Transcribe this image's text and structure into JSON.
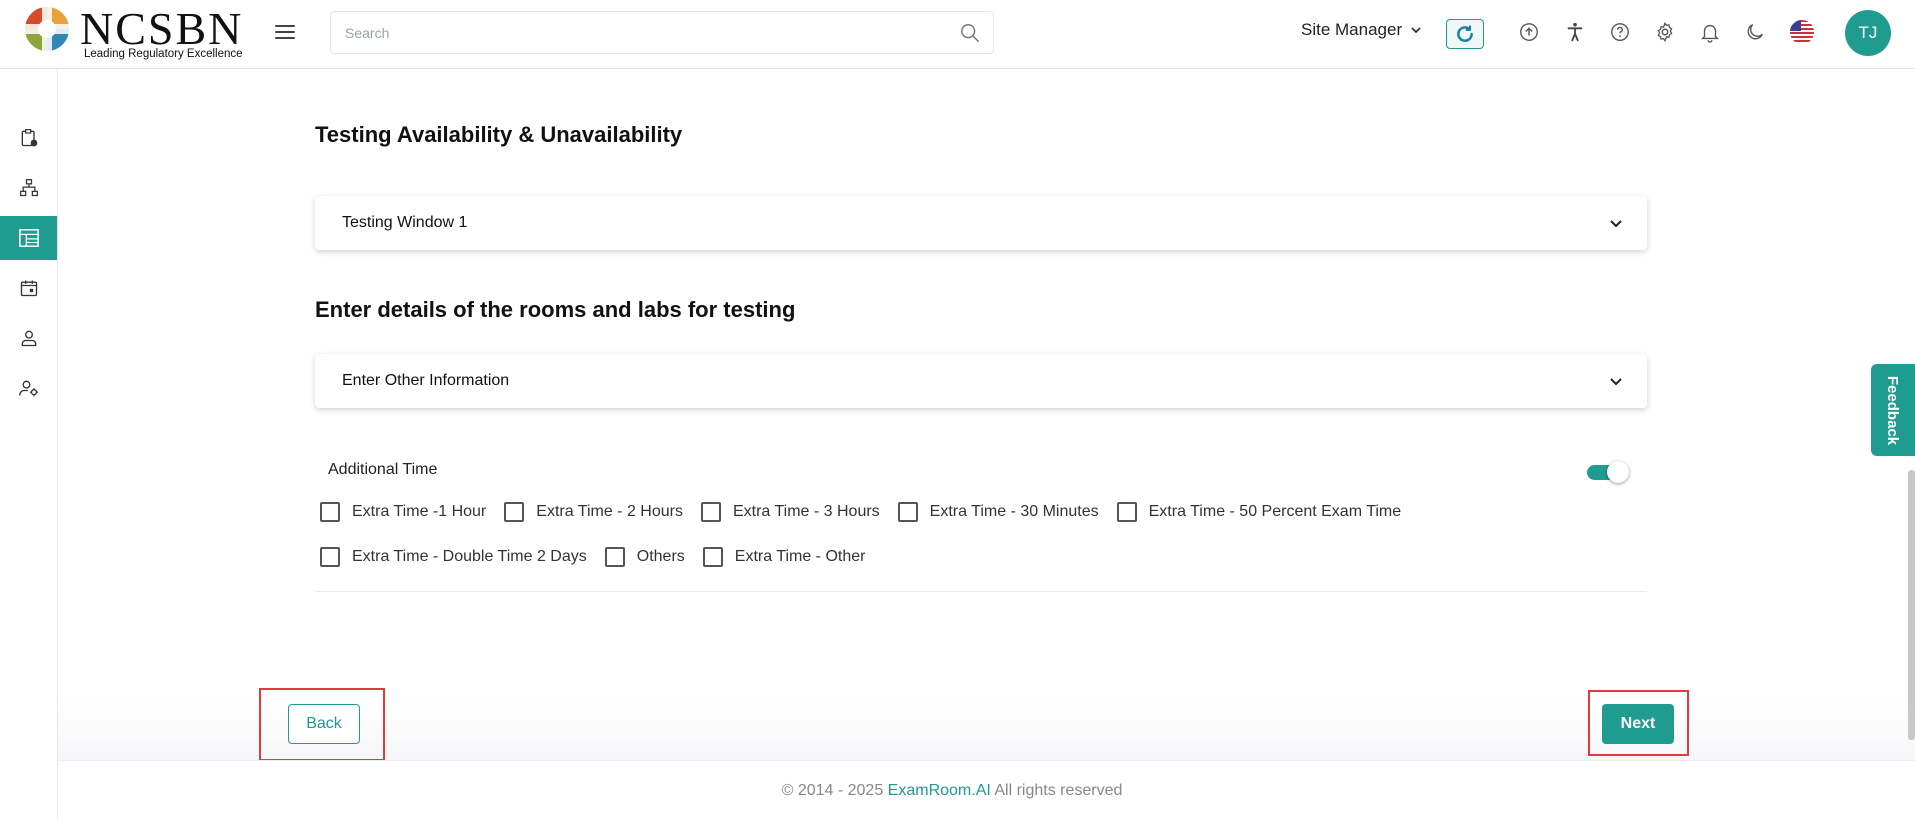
{
  "header": {
    "logo_text": "NCSBN",
    "logo_tagline": "Leading Regulatory Excellence",
    "search_placeholder": "Search",
    "role_label": "Site Manager",
    "avatar_initials": "TJ"
  },
  "sidebar": {
    "items": [
      {
        "icon": "clipboard-clock-icon",
        "active": false
      },
      {
        "icon": "sitemap-icon",
        "active": false
      },
      {
        "icon": "table-layout-icon",
        "active": true
      },
      {
        "icon": "calendar-icon",
        "active": false
      },
      {
        "icon": "user-icon",
        "active": false
      },
      {
        "icon": "user-settings-icon",
        "active": false
      }
    ]
  },
  "main": {
    "section1_title": "Testing Availability & Unavailability",
    "testing_window_label": "Testing Window 1",
    "section2_title": "Enter details of the rooms and labs for testing",
    "other_info_label": "Enter Other Information",
    "additional_time_label": "Additional Time",
    "additional_time_enabled": true,
    "checkbox_row1": [
      "Extra Time -1 Hour",
      "Extra Time - 2 Hours",
      "Extra Time - 3 Hours",
      "Extra Time - 30 Minutes",
      "Extra Time - 50 Percent Exam Time"
    ],
    "checkbox_row2": [
      "Extra Time - Double Time 2 Days",
      "Others",
      "Extra Time - Other"
    ]
  },
  "actions": {
    "back_label": "Back",
    "next_label": "Next"
  },
  "footer": {
    "copyright_prefix": "© 2014 - 2025",
    "brand": "ExamRoom.AI",
    "suffix": "All rights reserved"
  },
  "feedback_label": "Feedback",
  "colors": {
    "accent": "#1f9b8f",
    "highlight": "#e0393e"
  }
}
